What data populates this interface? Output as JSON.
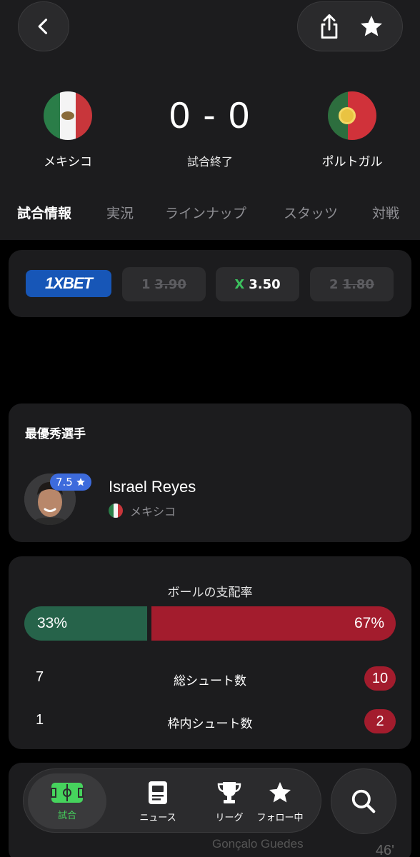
{
  "match": {
    "home_team": "メキシコ",
    "away_team": "ポルトガル",
    "score": "0 - 0",
    "status": "試合終了"
  },
  "tabs": [
    "試合情報",
    "実況",
    "ラインナップ",
    "スタッツ",
    "対戦"
  ],
  "odds": {
    "brand": "1XBET",
    "home": {
      "label": "1",
      "value": "3.90"
    },
    "draw": {
      "label": "X",
      "value": "3.50"
    },
    "away": {
      "label": "2",
      "value": "1.80"
    }
  },
  "mvp": {
    "title": "最優秀選手",
    "rating": "7.5",
    "player": "Israel Reyes",
    "team": "メキシコ"
  },
  "stats": {
    "possession_title": "ボールの支配率",
    "possession_home": "33%",
    "possession_away": "67%",
    "possession_home_fraction": 0.33,
    "rows": [
      {
        "home": "7",
        "label": "総シュート数",
        "away": "10"
      },
      {
        "home": "1",
        "label": "枠内シュート数",
        "away": "2"
      }
    ]
  },
  "peek": {
    "player": "Gonçalo Guedes",
    "minute": "46'"
  },
  "nav": [
    {
      "label": "試合",
      "icon": "pitch-icon"
    },
    {
      "label": "ニュース",
      "icon": "news-icon"
    },
    {
      "label": "リーグ",
      "icon": "trophy-icon"
    },
    {
      "label": "フォロー中",
      "icon": "star-icon"
    }
  ],
  "colors": {
    "home": "#26634a",
    "away": "#a31c2d",
    "accent": "#46d35d",
    "rating": "#3d6bdc",
    "bet_brand": "#1756b7"
  }
}
